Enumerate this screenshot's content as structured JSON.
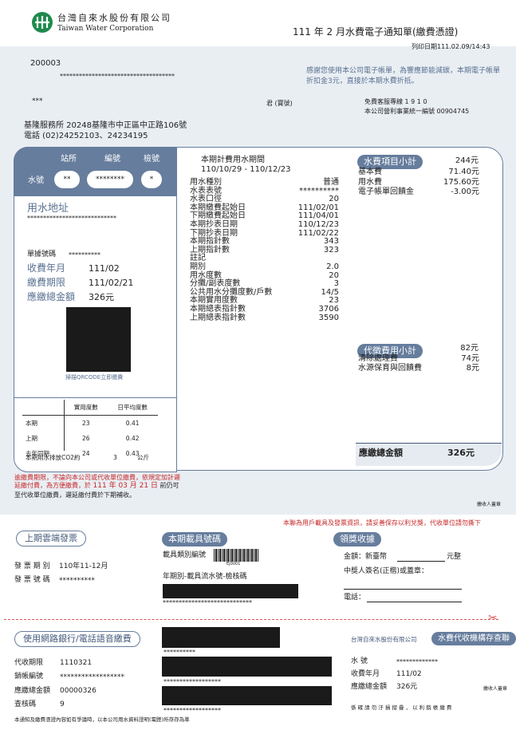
{
  "header": {
    "company_zh": "台灣自來水股份有限公司",
    "company_en": "Taiwan Water Corporation",
    "doc_title": "111 年 2 月水費電子通知單(繳費憑證)",
    "print_date": "列印日期111.02.09/14:43"
  },
  "customer": {
    "code": "200003",
    "masked_line": "************************************",
    "name": "***",
    "honorific": "君 (寶號)"
  },
  "notice": {
    "thanks": "感謝您使用本公司電子帳單，為響應節能減碳，本期電子帳單折扣金3元，直接於本期水費折抵。",
    "hotline": "免費客服專線 1 9 1 0",
    "tax_id": "本公司營利事業統一編號 00904745"
  },
  "office": {
    "line1": "基隆服務所  20248基隆市中正區中正路106號",
    "line2": "電話 (02)24252103、24234195"
  },
  "account": {
    "hdr_station": "站所",
    "hdr_number": "編號",
    "hdr_check": "檢號",
    "label": "水號",
    "station": "**",
    "number": "********",
    "check": "*"
  },
  "left_panel": {
    "addr_label": "用水地址",
    "addr_value": "****************************",
    "doc_no_label": "單據號碼",
    "doc_no_value": "**********",
    "ym_label": "收費年月",
    "ym_value": "111/02",
    "due_label": "繳費期限",
    "due_value": "111/02/21",
    "total_label": "應繳總金額",
    "total_value": "326元",
    "qr_caption": "掃描QRCODE立即繳費"
  },
  "usage_table": {
    "headers": [
      "",
      "實用度數",
      "日平均度數"
    ],
    "rows": [
      [
        "本期",
        "23",
        "0.41"
      ],
      [
        "上期",
        "26",
        "0.42"
      ],
      [
        "去年同期",
        "24",
        "0.43"
      ]
    ],
    "co2_label": "本期用水排放CO2約",
    "co2_value": "3",
    "co2_unit": "公斤"
  },
  "period": {
    "label": "本期計費用水期間",
    "value": "110/10/29 - 110/12/23"
  },
  "details": [
    {
      "label": "用水種別",
      "value": "普通"
    },
    {
      "label": "水表表號",
      "value": "**********"
    },
    {
      "label": "水表口徑",
      "value": "20"
    },
    {
      "label": "本期繳費起始日",
      "value": "111/02/01"
    },
    {
      "label": "下期繳費起始日",
      "value": "111/04/01"
    },
    {
      "label": "本期抄表日期",
      "value": "110/12/23"
    },
    {
      "label": "下期抄表日期",
      "value": "111/02/22"
    },
    {
      "label": "本期指針數",
      "value": "343"
    },
    {
      "label": "上期指針數",
      "value": "323"
    },
    {
      "label": "註記",
      "value": ""
    },
    {
      "label": "期別",
      "value": "2.0"
    },
    {
      "label": "用水度數",
      "value": "20"
    },
    {
      "label": "分攤/副表度數",
      "value": "3"
    },
    {
      "label": "公共用水分攤度數/戶數",
      "value": "14/5"
    },
    {
      "label": "本期實用度數",
      "value": "23"
    },
    {
      "label": "本期總表指針數",
      "value": "3706"
    },
    {
      "label": "上期總表指針數",
      "value": "3590"
    }
  ],
  "water_items": {
    "title": "水費項目小計",
    "total": "244元",
    "items": [
      {
        "label": "基本費",
        "value": "71.40元"
      },
      {
        "label": "用水費",
        "value": "175.60元"
      },
      {
        "label": "電子帳單回饋金",
        "value": "-3.00元"
      }
    ]
  },
  "collect_items": {
    "title": "代徵費用小計",
    "total": "82元",
    "items": [
      {
        "label": "清除處理費",
        "value": "74元"
      },
      {
        "label": "水源保育與回饋費",
        "value": "8元"
      }
    ]
  },
  "grand_total": {
    "label": "應繳總金額",
    "value": "326元"
  },
  "warning": {
    "line1": "逾繳費期限，不論向本公司或代收單位繳費，依規定加計遲",
    "line2_pre": "延繳付費，為方便繳費，於",
    "line2_date": "111 年 03 月 21 日",
    "line2_post": "前仍可",
    "line3": "至代收單位繳費，遲延繳付費於下期補收。",
    "stamp": "繳收人蓋章"
  },
  "receipt": {
    "notice": "本聯為用戶載具及發票資訊，請妥善保存以利兌獎，代收單位請勿撕下",
    "invoice_title": "上期雲端發票",
    "inv_period_label": "發 票 期 別",
    "inv_period_value": "110年11-12月",
    "inv_no_label": "發 票 號 碼",
    "inv_no_value": "**********",
    "carrier_title": "本期載具號碼",
    "carrier_type_label": "載具類別編號",
    "carrier_code": "EJ0001",
    "carrier_detail_label": "年期別-載具流水號-檢核碼",
    "carrier_masked": "****************************",
    "prize_title": "領獎收據",
    "amount_label": "金額：新臺幣",
    "amount_unit": "元整",
    "winner_label": "中獎人簽名(正楷)或蓋章：",
    "phone_label": "電話："
  },
  "stub": {
    "online_title": "使用網路銀行/電話語音繳費",
    "due_label": "代收期限",
    "due_value": "1110321",
    "acct_label": "銷帳編號",
    "acct_value": "******************",
    "amt_label": "應繳總金額",
    "amt_value": "00000326",
    "check_label": "查核碼",
    "check_value": "9",
    "bar1": "**********",
    "bar2": "******************",
    "bar3": "******************",
    "company": "台灣自來水股份有限公司",
    "stub_title": "水費代收機構存查聯",
    "wno_label": "水  號",
    "wno_value": "*************",
    "ym_label": "收費年月",
    "ym_value": "111/02",
    "total_label": "應繳總金額",
    "total_value": "326元",
    "stamp": "繳收人蓋章",
    "bottom_note": "本通知及繳費憑證內容如有爭議時，以本公司用水資料證明(電謄)所存存為準",
    "keep_note": "係 確 請 勿 汙 損 摺 疊 ， 以 利 銷 帳 繳 費"
  }
}
